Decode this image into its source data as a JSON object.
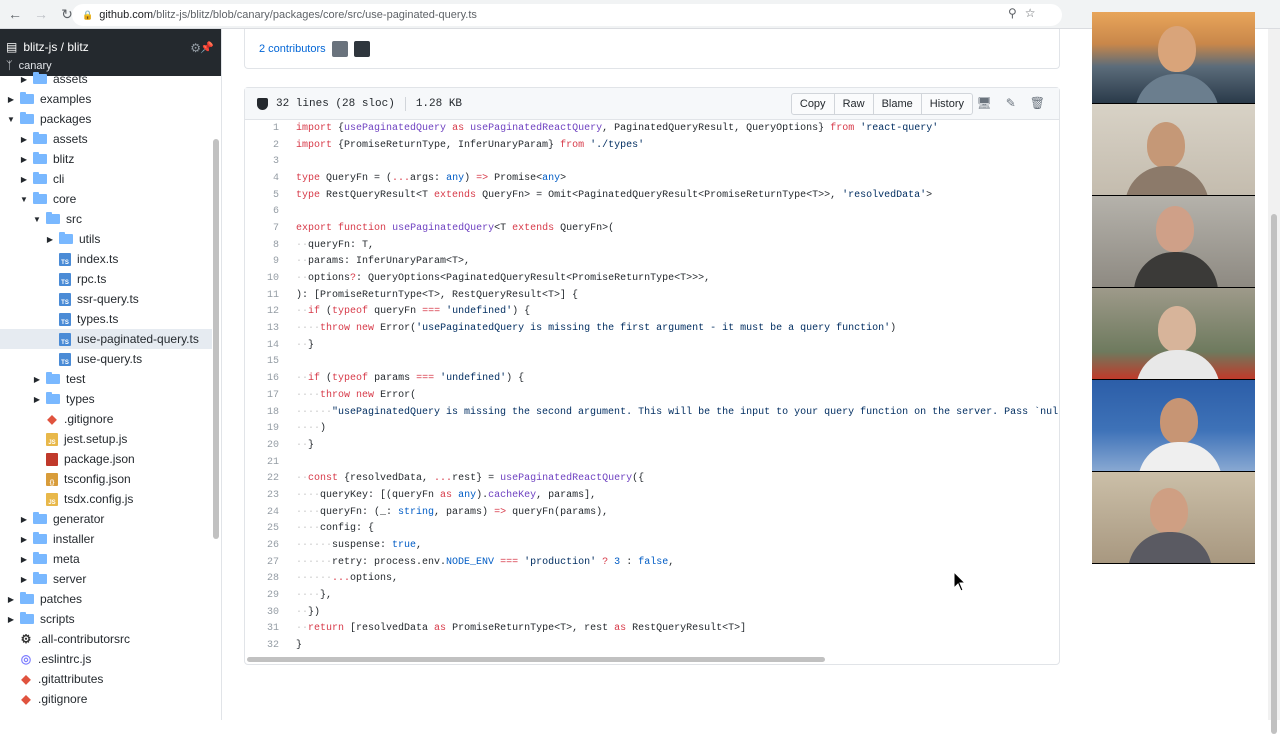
{
  "browser": {
    "url_host": "github.com",
    "url_path": "/blitz-js/blitz/blob/canary/packages/core/src/use-paginated-query.ts"
  },
  "sidebar": {
    "repo": "blitz-js / blitz",
    "branch": "canary",
    "tree": [
      {
        "label": "assets",
        "type": "folder",
        "depth": 1,
        "open": false
      },
      {
        "label": "examples",
        "type": "folder",
        "depth": 0,
        "open": false
      },
      {
        "label": "packages",
        "type": "folder",
        "depth": 0,
        "open": true
      },
      {
        "label": "assets",
        "type": "folder",
        "depth": 1,
        "open": false
      },
      {
        "label": "blitz",
        "type": "folder",
        "depth": 1,
        "open": false
      },
      {
        "label": "cli",
        "type": "folder",
        "depth": 1,
        "open": false
      },
      {
        "label": "core",
        "type": "folder",
        "depth": 1,
        "open": true
      },
      {
        "label": "src",
        "type": "folder",
        "depth": 2,
        "open": true
      },
      {
        "label": "utils",
        "type": "folder",
        "depth": 3,
        "open": false
      },
      {
        "label": "index.ts",
        "type": "ts",
        "depth": 3
      },
      {
        "label": "rpc.ts",
        "type": "ts",
        "depth": 3
      },
      {
        "label": "ssr-query.ts",
        "type": "ts",
        "depth": 3
      },
      {
        "label": "types.ts",
        "type": "ts",
        "depth": 3
      },
      {
        "label": "use-paginated-query.ts",
        "type": "ts",
        "depth": 3,
        "selected": true
      },
      {
        "label": "use-query.ts",
        "type": "ts",
        "depth": 3
      },
      {
        "label": "test",
        "type": "folder",
        "depth": 2,
        "open": false
      },
      {
        "label": "types",
        "type": "folder",
        "depth": 2,
        "open": false
      },
      {
        "label": ".gitignore",
        "type": "git",
        "depth": 2
      },
      {
        "label": "jest.setup.js",
        "type": "js",
        "depth": 2
      },
      {
        "label": "package.json",
        "type": "pkg",
        "depth": 2
      },
      {
        "label": "tsconfig.json",
        "type": "json",
        "depth": 2
      },
      {
        "label": "tsdx.config.js",
        "type": "js",
        "depth": 2
      },
      {
        "label": "generator",
        "type": "folder",
        "depth": 1,
        "open": false
      },
      {
        "label": "installer",
        "type": "folder",
        "depth": 1,
        "open": false
      },
      {
        "label": "meta",
        "type": "folder",
        "depth": 1,
        "open": false
      },
      {
        "label": "server",
        "type": "folder",
        "depth": 1,
        "open": false
      },
      {
        "label": "patches",
        "type": "folder",
        "depth": 0,
        "open": false
      },
      {
        "label": "scripts",
        "type": "folder",
        "depth": 0,
        "open": false
      },
      {
        "label": ".all-contributorsrc",
        "type": "rc",
        "depth": 0
      },
      {
        "label": ".eslintrc.js",
        "type": "eslint",
        "depth": 0
      },
      {
        "label": ".gitattributes",
        "type": "git",
        "depth": 0
      },
      {
        "label": ".gitignore",
        "type": "git",
        "depth": 0
      }
    ]
  },
  "commit": {
    "contributors": "2 contributors"
  },
  "file": {
    "lines_info": "32 lines (28 sloc)",
    "size": "1.28 KB",
    "actions": [
      "Copy",
      "Raw",
      "Blame",
      "History"
    ]
  },
  "code": [
    "import {usePaginatedQuery as usePaginatedReactQuery, PaginatedQueryResult, QueryOptions} from 'react-query'",
    "import {PromiseReturnType, InferUnaryParam} from './types'",
    "",
    "type QueryFn = (...args: any) => Promise<any>",
    "type RestQueryResult<T extends QueryFn> = Omit<PaginatedQueryResult<PromiseReturnType<T>>, 'resolvedData'>",
    "",
    "export function usePaginatedQuery<T extends QueryFn>(",
    "··queryFn: T,",
    "··params: InferUnaryParam<T>,",
    "··options?: QueryOptions<PaginatedQueryResult<PromiseReturnType<T>>>,",
    "): [PromiseReturnType<T>, RestQueryResult<T>] {",
    "··if (typeof queryFn === 'undefined') {",
    "····throw new Error('usePaginatedQuery is missing the first argument - it must be a query function')",
    "··}",
    "",
    "··if (typeof params === 'undefined') {",
    "····throw new Error(",
    "······\"usePaginatedQuery is missing the second argument. This will be the input to your query function on the server. Pass `nul",
    "····)",
    "··}",
    "",
    "··const {resolvedData, ...rest} = usePaginatedReactQuery({",
    "····queryKey: [(queryFn as any).cacheKey, params],",
    "····queryFn: (_: string, params) => queryFn(params),",
    "····config: {",
    "······suspense: true,",
    "······retry: process.env.NODE_ENV === 'production' ? 3 : false,",
    "······...options,",
    "····},",
    "··})",
    "··return [resolvedData as PromiseReturnType<T>, rest as RestQueryResult<T>]",
    "}"
  ]
}
